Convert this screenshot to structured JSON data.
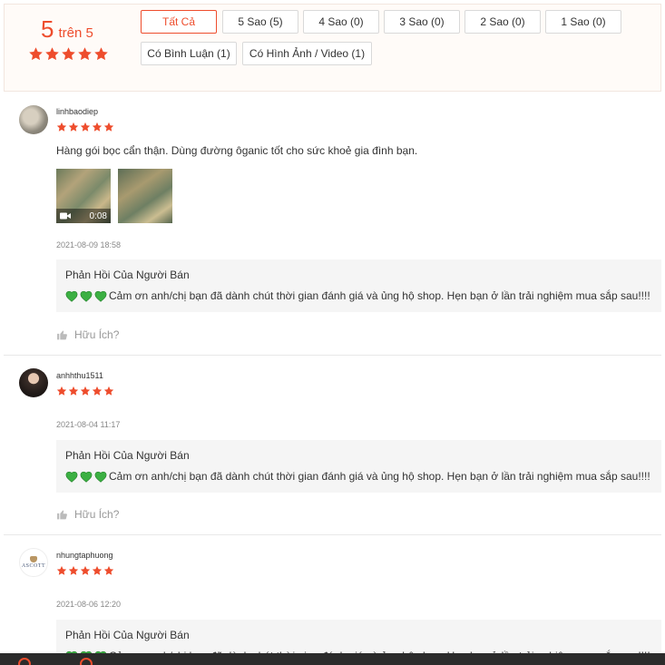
{
  "summary": {
    "score": "5",
    "of_label": "trên 5",
    "filters": [
      {
        "label": "Tất Cả",
        "active": true
      },
      {
        "label": "5 Sao (5)",
        "active": false
      },
      {
        "label": "4 Sao (0)",
        "active": false
      },
      {
        "label": "3 Sao (0)",
        "active": false
      },
      {
        "label": "2 Sao (0)",
        "active": false
      },
      {
        "label": "1 Sao (0)",
        "active": false
      },
      {
        "label": "Có Bình Luận (1)",
        "active": false
      },
      {
        "label": "Có Hình Ảnh / Video (1)",
        "active": false
      }
    ]
  },
  "colors": {
    "accent": "#ee4d2d",
    "heart": "#3cb043"
  },
  "reviews": [
    {
      "username": "linhbaodiep",
      "stars": 5,
      "comment": "Hàng gói bọc cẩn thận. Dùng đường ôganic tốt cho sức khoẻ gia đình bạn.",
      "video_duration": "0:08",
      "date": "2021-08-09 18:58",
      "reply_title": "Phản Hồi Của Người Bán",
      "reply_text": "Cảm ơn anh/chị bạn đã dành chút thời gian đánh giá và ủng hộ shop. Hẹn bạn ở lần trải nghiệm mua sắp sau!!!!",
      "helpful_label": "Hữu Ích?"
    },
    {
      "username": "anhhthu1511",
      "stars": 5,
      "date": "2021-08-04 11:17",
      "reply_title": "Phản Hồi Của Người Bán",
      "reply_text": "Cảm ơn anh/chị bạn đã dành chút thời gian đánh giá và ủng hộ shop. Hẹn bạn ở lần trải nghiệm mua sắp sau!!!!",
      "helpful_label": "Hữu Ích?"
    },
    {
      "username": "nhungtaphuong",
      "avatar_text": "ASCOTT",
      "stars": 5,
      "date": "2021-08-06 12:20",
      "reply_title": "Phản Hồi Của Người Bán",
      "reply_text": "Cảm ơn anh/chị bạn đã dành chút thời gian đánh giá và ủng hộ shop. Hẹn bạn ở lần trải nghiệm mua sắp sau!!!!"
    }
  ]
}
